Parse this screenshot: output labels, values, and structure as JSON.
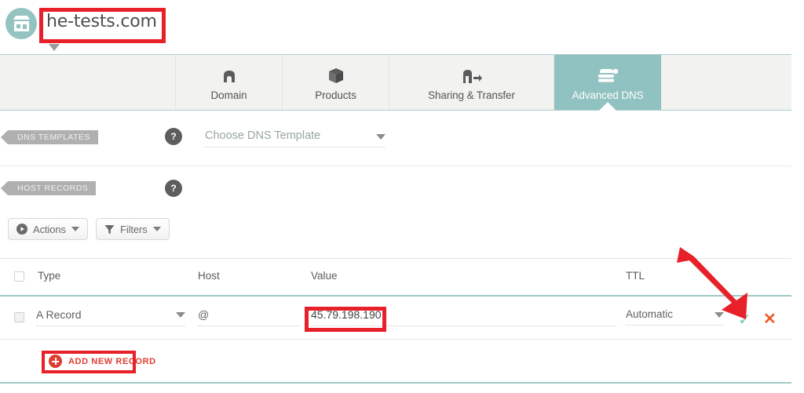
{
  "header": {
    "domain": "he-tests.com",
    "logo_icon": "storefront-icon",
    "caret_icon": "caret-down-icon"
  },
  "tabs": [
    {
      "label": "Domain",
      "icon": "home-icon",
      "active": false
    },
    {
      "label": "Products",
      "icon": "box-icon",
      "active": false
    },
    {
      "label": "Sharing & Transfer",
      "icon": "share-arrow-icon",
      "active": false
    },
    {
      "label": "Advanced DNS",
      "icon": "server-icon",
      "active": true
    }
  ],
  "sections": {
    "dns_templates": {
      "title": "DNS TEMPLATES",
      "help_icon": "question-mark-icon",
      "select_value": "Choose DNS Template",
      "select_arrow": "chevron-down-icon"
    },
    "host_records": {
      "title": "HOST RECORDS",
      "help_icon": "question-mark-icon"
    }
  },
  "toolbar": {
    "actions_label": "Actions",
    "actions_icon": "play-circle-icon",
    "filters_label": "Filters",
    "filters_icon": "funnel-icon",
    "dropdown_icon": "caret-down-icon"
  },
  "table": {
    "columns": [
      "Type",
      "Host",
      "Value",
      "TTL"
    ],
    "rows": [
      {
        "type": "A Record",
        "host": "@",
        "value": "45.79.198.190",
        "ttl": "Automatic",
        "confirm_icon": "check-icon",
        "delete_icon": "close-x-icon"
      }
    ]
  },
  "add_record": {
    "label": "ADD NEW RECORD",
    "icon": "plus-circle-icon"
  },
  "annotations": {
    "highlight_color": "#e8202a",
    "arrow_color": "#e8202a",
    "arrow_target": "confirm-check-icon"
  },
  "colors": {
    "accent_teal": "#8fc2c0",
    "tab_bar_bg": "#f2f2f1",
    "confirm_green": "#79c4bd",
    "delete_orange": "#f05a28",
    "add_red": "#e13b2f"
  }
}
